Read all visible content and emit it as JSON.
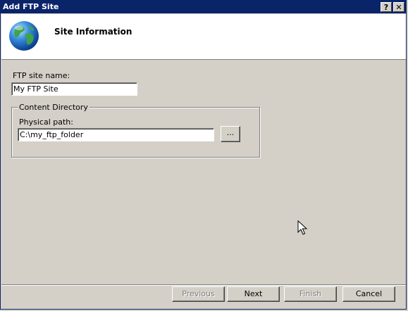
{
  "window": {
    "title": "Add FTP Site",
    "help_glyph": "?",
    "close_glyph": "✕"
  },
  "header": {
    "title": "Site Information",
    "icon": "globe-icon"
  },
  "form": {
    "site_name_label": "FTP site name:",
    "site_name_value": "My FTP Site",
    "content_group_label": "Content Directory",
    "physical_path_label": "Physical path:",
    "physical_path_value": "C:\\my_ftp_folder",
    "browse_label": "..."
  },
  "footer": {
    "previous_label": "Previous",
    "next_label": "Next",
    "finish_label": "Finish",
    "cancel_label": "Cancel"
  },
  "colors": {
    "titlebar": "#0a246a",
    "face": "#d4d0c8",
    "header_bg": "#ffffff"
  }
}
